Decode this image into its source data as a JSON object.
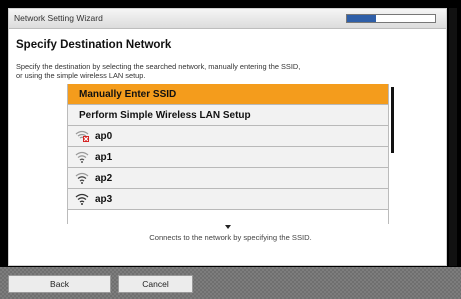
{
  "window": {
    "title": "Network Setting Wizard",
    "progress": 0.33
  },
  "page": {
    "heading": "Specify Destination Network",
    "description_line1": "Specify the destination by selecting the searched network, manually entering the SSID,",
    "description_line2": "or using the simple wireless LAN setup."
  },
  "list": {
    "options": [
      {
        "label": "Manually Enter SSID",
        "selected": true
      },
      {
        "label": "Perform Simple Wireless LAN Setup",
        "selected": false
      }
    ],
    "networks": [
      {
        "name": "ap0",
        "icon": "wifi-locked-icon"
      },
      {
        "name": "ap1",
        "icon": "wifi-icon"
      },
      {
        "name": "ap2",
        "icon": "wifi-icon"
      },
      {
        "name": "ap3",
        "icon": "wifi-strong-icon"
      }
    ]
  },
  "help_text": "Connects to the network by specifying the SSID.",
  "footer": {
    "back_label": "Back",
    "cancel_label": "Cancel"
  },
  "colors": {
    "selected_row": "#f49c1c",
    "progress_fill": "#2f5fa8"
  }
}
